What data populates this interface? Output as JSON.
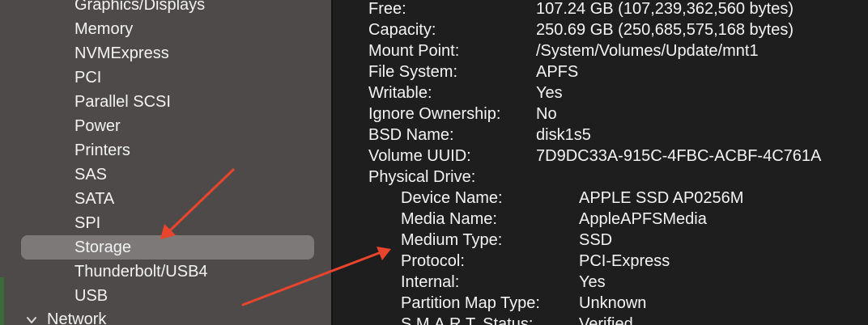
{
  "sidebar": {
    "items": [
      {
        "label": "Graphics/Displays",
        "selected": false
      },
      {
        "label": "Memory",
        "selected": false
      },
      {
        "label": "NVMExpress",
        "selected": false
      },
      {
        "label": "PCI",
        "selected": false
      },
      {
        "label": "Parallel SCSI",
        "selected": false
      },
      {
        "label": "Power",
        "selected": false
      },
      {
        "label": "Printers",
        "selected": false
      },
      {
        "label": "SAS",
        "selected": false
      },
      {
        "label": "SATA",
        "selected": false
      },
      {
        "label": "SPI",
        "selected": false
      },
      {
        "label": "Storage",
        "selected": true
      },
      {
        "label": "Thunderbolt/USB4",
        "selected": false
      },
      {
        "label": "USB",
        "selected": false
      }
    ],
    "group": {
      "label": "Network",
      "expanded": true
    }
  },
  "detail": {
    "fields": [
      {
        "label": "Free:",
        "value": "107.24 GB (107,239,362,560 bytes)"
      },
      {
        "label": "Capacity:",
        "value": "250.69 GB (250,685,575,168 bytes)"
      },
      {
        "label": "Mount Point:",
        "value": "/System/Volumes/Update/mnt1"
      },
      {
        "label": "File System:",
        "value": "APFS"
      },
      {
        "label": "Writable:",
        "value": "Yes"
      },
      {
        "label": "Ignore Ownership:",
        "value": "No"
      },
      {
        "label": "BSD Name:",
        "value": "disk1s5"
      },
      {
        "label": "Volume UUID:",
        "value": "7D9DC33A-915C-4FBC-ACBF-4C761A"
      },
      {
        "label": "Physical Drive:",
        "value": ""
      }
    ],
    "physical_drive": [
      {
        "label": "Device Name:",
        "value": "APPLE SSD AP0256M"
      },
      {
        "label": "Media Name:",
        "value": "AppleAPFSMedia"
      },
      {
        "label": "Medium Type:",
        "value": "SSD"
      },
      {
        "label": "Protocol:",
        "value": "PCI-Express"
      },
      {
        "label": "Internal:",
        "value": "Yes"
      },
      {
        "label": "Partition Map Type:",
        "value": "Unknown"
      },
      {
        "label": "S.M.A.R.T. Status:",
        "value": "Verified"
      }
    ]
  },
  "colors": {
    "sidebar_bg": "#4f4a4a",
    "selection_bg": "#7d7979",
    "detail_bg": "#1e1e1e",
    "text": "#f4f4f4",
    "annotation_arrow": "#e8452c"
  }
}
